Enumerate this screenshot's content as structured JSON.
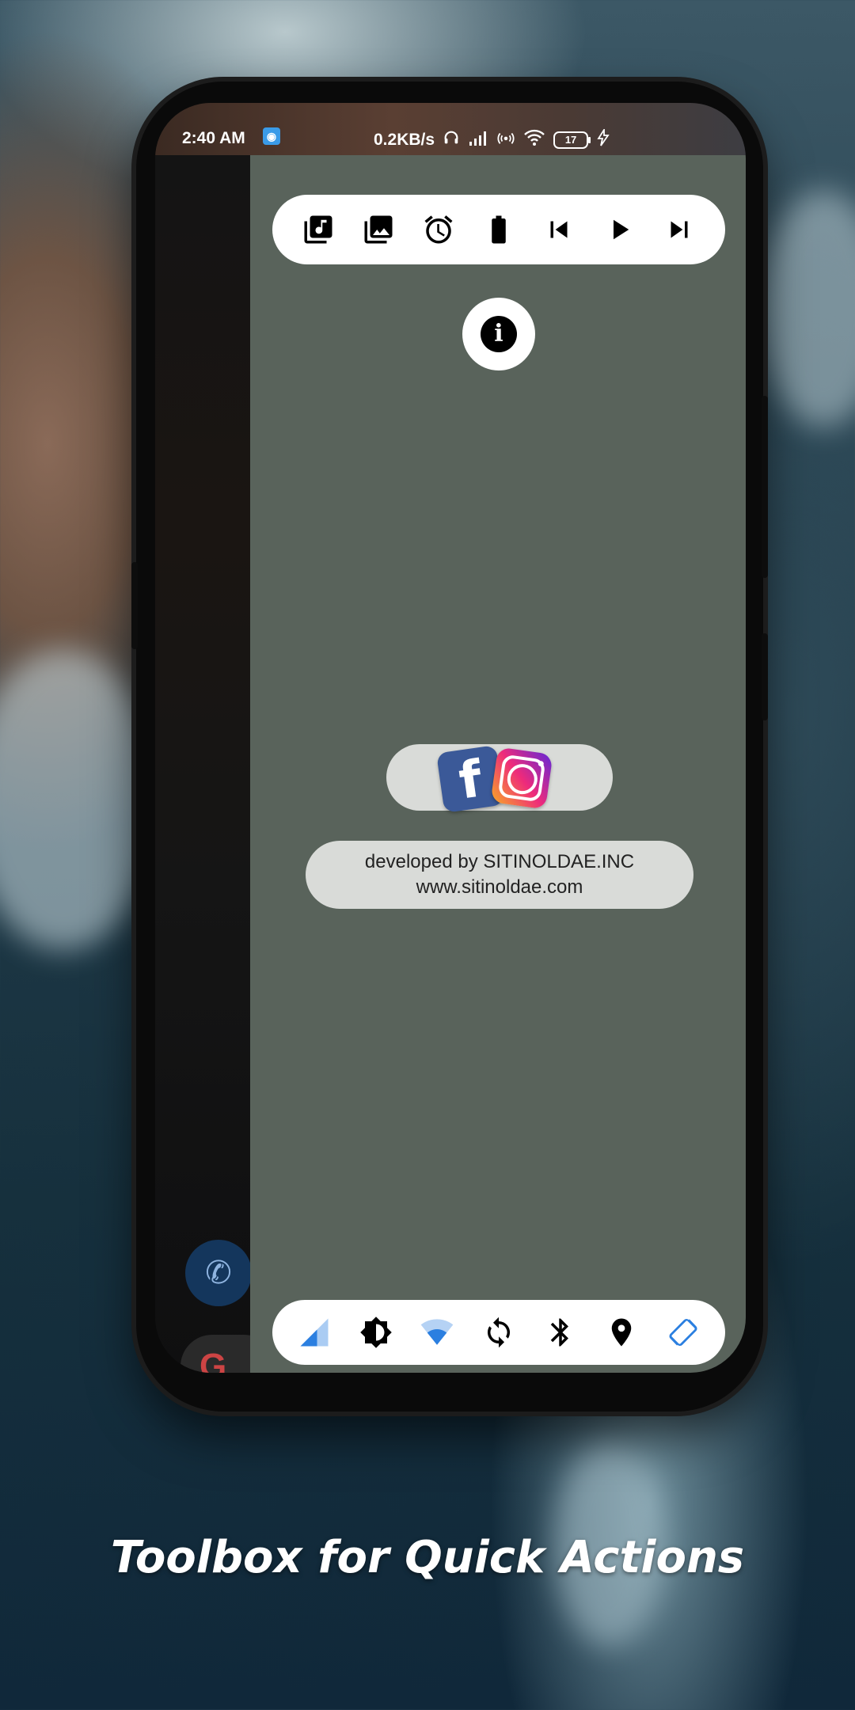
{
  "statusbar": {
    "time": "2:40 AM",
    "net_speed": "0.2KB/s",
    "battery_level": "17",
    "icons": [
      "screen-recorder-icon",
      "headset-icon",
      "signal-icon",
      "hotspot-icon",
      "wifi-icon",
      "battery-icon",
      "charging-icon"
    ]
  },
  "top_toolbar": {
    "items": [
      "music-library-icon",
      "gallery-icon",
      "alarm-icon",
      "battery-icon",
      "skip-previous-icon",
      "play-icon",
      "skip-next-icon"
    ]
  },
  "info_button": {
    "icon": "info-icon"
  },
  "social": {
    "icons": [
      "facebook-icon",
      "instagram-icon"
    ]
  },
  "developer": {
    "line1": "developed by SITINOLDAE.INC",
    "line2": "www.sitinoldae.com"
  },
  "bottom_toolbar": {
    "items": [
      "mobile-data-icon",
      "brightness-icon",
      "wifi-icon",
      "sync-icon",
      "bluetooth-icon",
      "location-icon",
      "auto-rotate-icon"
    ],
    "accent": "#2b7fe0"
  },
  "caption": "Toolbox for Quick Actions"
}
